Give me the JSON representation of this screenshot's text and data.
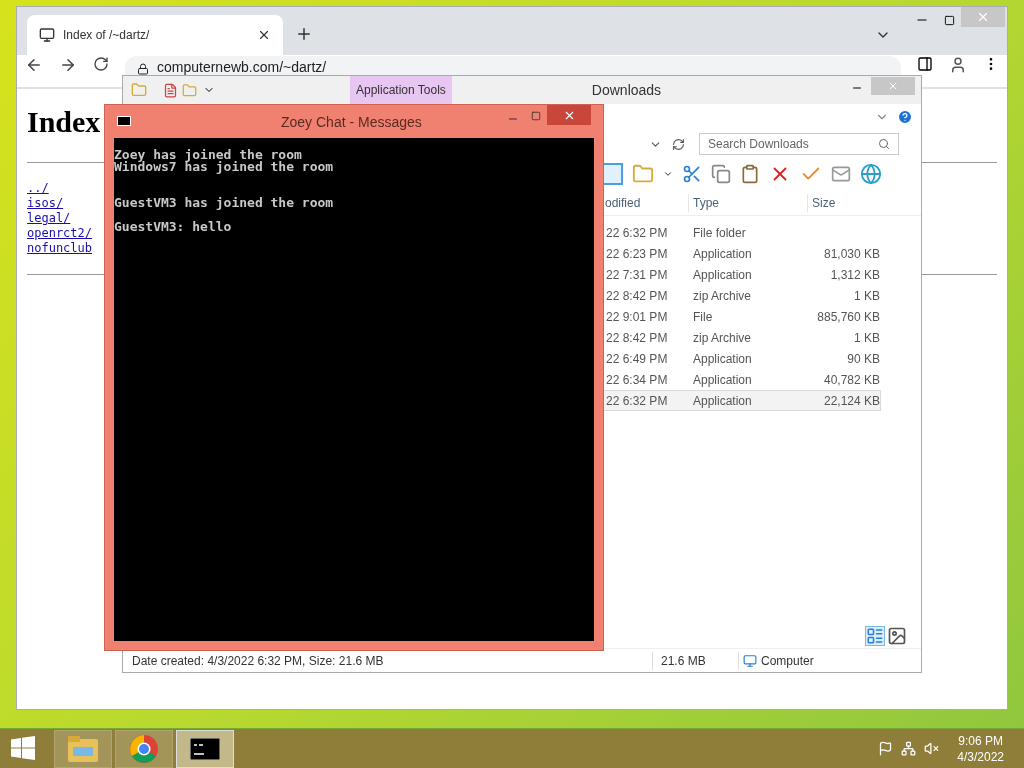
{
  "browser": {
    "tab_title": "Index of /~dartz/",
    "url": "computernewb.com/~dartz/",
    "heading": "Index",
    "links": [
      "../",
      "isos/",
      "legal/",
      "openrct2/",
      "nofunclub"
    ]
  },
  "explorer": {
    "title": "Downloads",
    "ribbon_tab": "Application Tools",
    "search": {
      "placeholder": "Search Downloads"
    },
    "columns": [
      "odified",
      "Type",
      "Size"
    ],
    "rows": [
      {
        "modified": "22 6:32 PM",
        "type": "File folder",
        "size": "",
        "selected": false
      },
      {
        "modified": "22 6:23 PM",
        "type": "Application",
        "size": "81,030 KB",
        "selected": false
      },
      {
        "modified": "22 7:31 PM",
        "type": "Application",
        "size": "1,312 KB",
        "selected": false
      },
      {
        "modified": "22 8:42 PM",
        "type": "zip Archive",
        "size": "1 KB",
        "selected": false
      },
      {
        "modified": "22 9:01 PM",
        "type": "File",
        "size": "885,760 KB",
        "selected": false
      },
      {
        "modified": "22 8:42 PM",
        "type": "zip Archive",
        "size": "1 KB",
        "selected": false
      },
      {
        "modified": "22 6:49 PM",
        "type": "Application",
        "size": "90 KB",
        "selected": false
      },
      {
        "modified": "22 6:34 PM",
        "type": "Application",
        "size": "40,782 KB",
        "selected": false
      },
      {
        "modified": "22 6:32 PM",
        "type": "Application",
        "size": "22,124 KB",
        "selected": true
      }
    ],
    "status": {
      "details": "Date created: 4/3/2022 6:32 PM, Size: 21.6 MB",
      "size": "21.6 MB",
      "location": "Computer"
    }
  },
  "chat": {
    "title": "Zoey Chat - Messages",
    "output": "Zoey has joined the room\nWindows7 has joined the room\n\n\nGuestVM3 has joined the room\n\nGuestVM3: hello"
  },
  "taskbar": {
    "apps": [
      {
        "kind": "explorer",
        "selected": false
      },
      {
        "kind": "chrome",
        "selected": false
      },
      {
        "kind": "console",
        "selected": true
      }
    ],
    "time": "9:06 PM",
    "date": "4/3/2022"
  }
}
